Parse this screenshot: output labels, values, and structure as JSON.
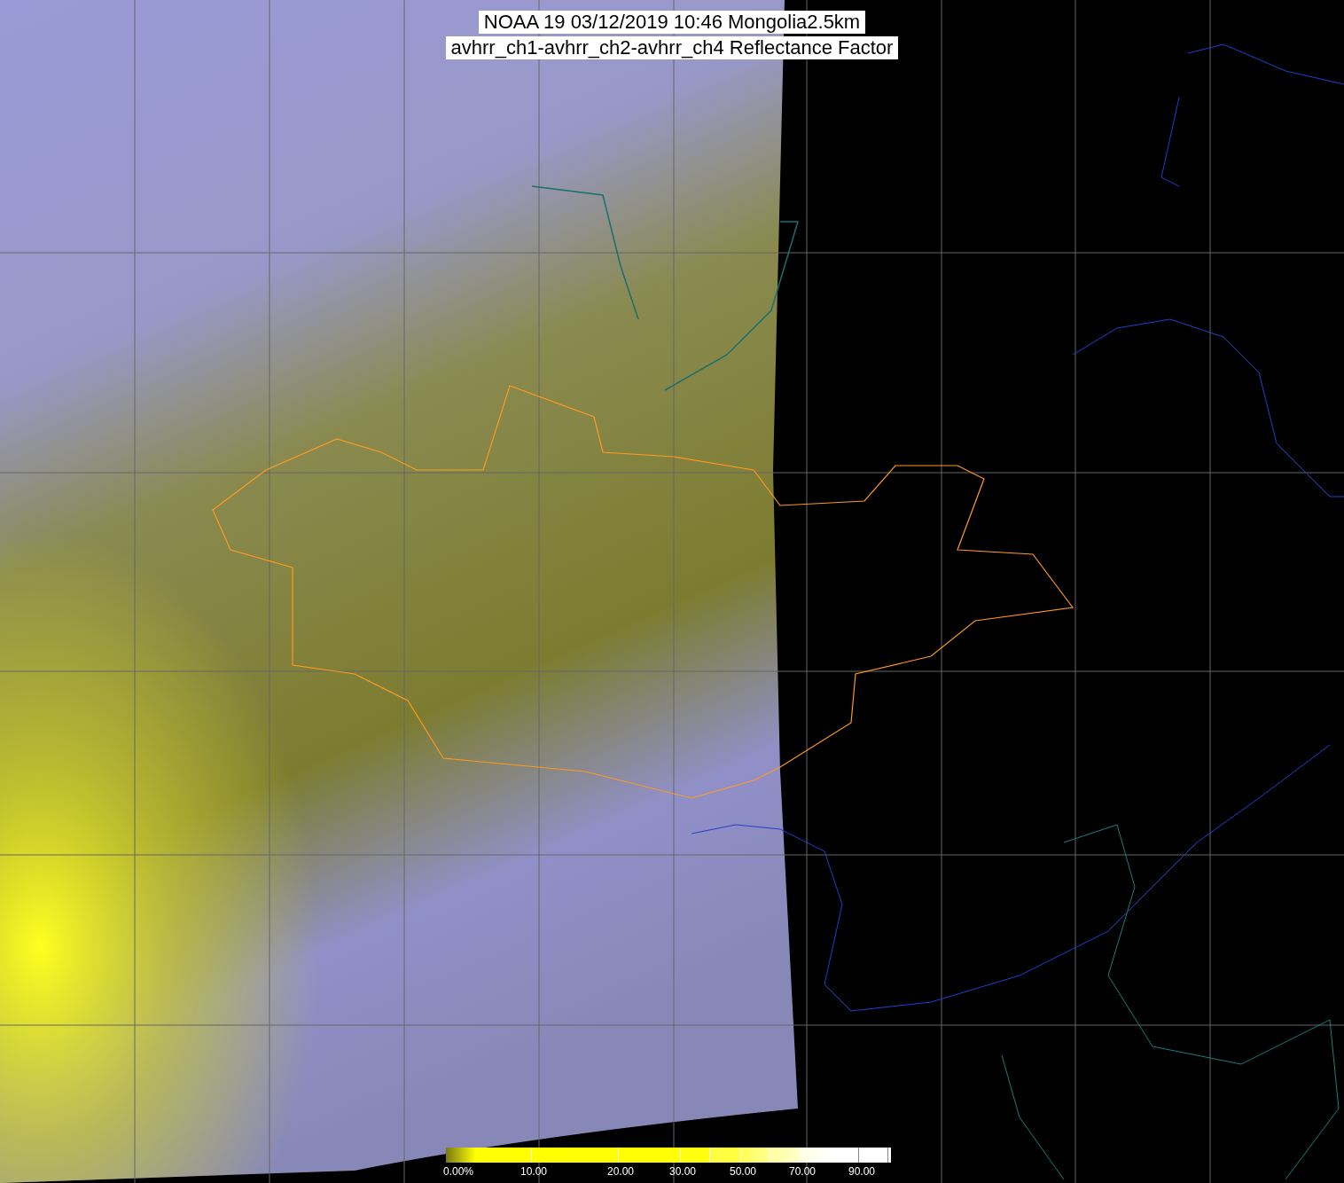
{
  "title": {
    "lines": [
      "NOAA 19 03/12/2019 10:46 Mongolia2.5km",
      "avhrr_ch1-avhrr_ch2-avhrr_ch4 Reflectance Factor"
    ]
  },
  "colorbar": {
    "ticks": [
      "0.00%",
      "10.00",
      "20.00",
      "30.00",
      "50.00",
      "70.00",
      "90.00"
    ]
  }
}
